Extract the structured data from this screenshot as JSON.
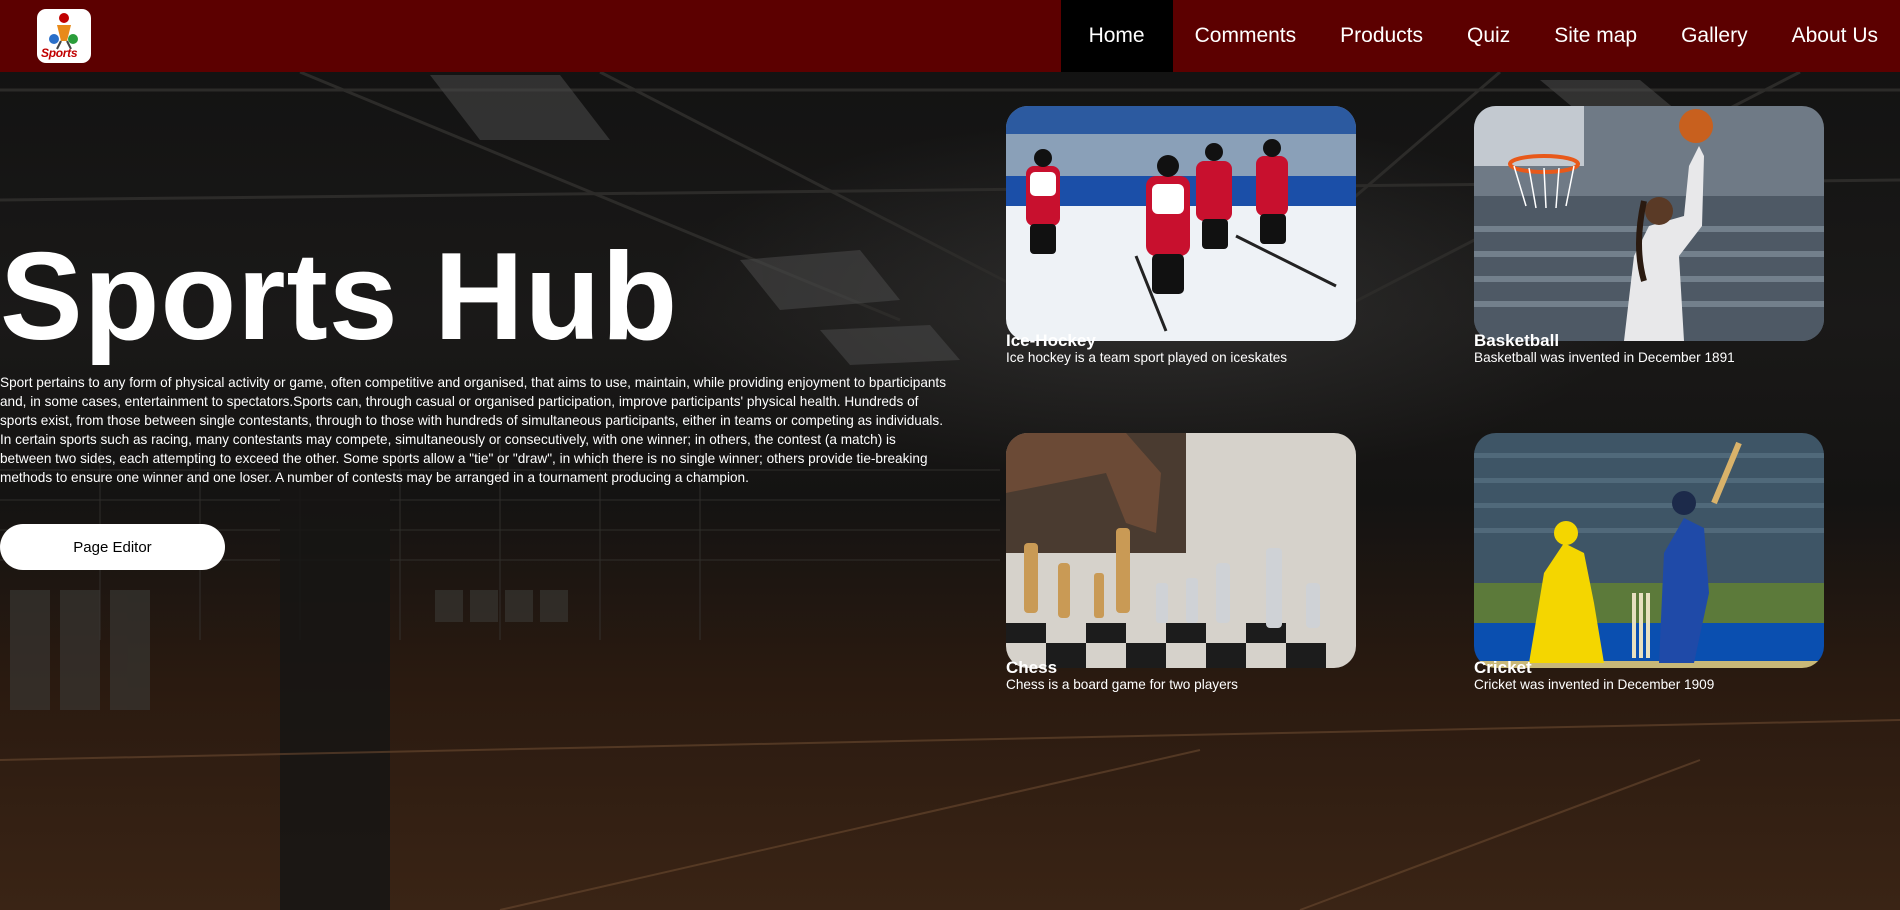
{
  "header": {
    "logo_text": "Sports",
    "nav": [
      {
        "label": "Home",
        "active": true
      },
      {
        "label": "Comments",
        "active": false
      },
      {
        "label": "Products",
        "active": false
      },
      {
        "label": "Quiz",
        "active": false
      },
      {
        "label": "Site map",
        "active": false
      },
      {
        "label": "Gallery",
        "active": false
      },
      {
        "label": "About Us",
        "active": false
      }
    ]
  },
  "hero": {
    "title": "Sports Hub",
    "text": "Sport pertains to any form of physical activity or game, often competitive and organised, that aims to use, maintain, while providing enjoyment to bparticipants and, in some cases, entertainment to spectators.Sports can, through casual or organised participation, improve participants' physical health. Hundreds of sports exist, from those between single contestants, through to those with hundreds of simultaneous participants, either in teams or competing as individuals. In certain sports such as racing, many contestants may compete, simultaneously or consecutively, with one winner; in others, the contest (a match) is between two sides, each attempting to exceed the other. Some sports allow a \"tie\" or \"draw\", in which there is no single winner; others provide tie-breaking methods to ensure one winner and one loser. A number of contests may be arranged in a tournament producing a champion.",
    "button_label": "Page Editor"
  },
  "cards": [
    {
      "title": "Ice-Hockey",
      "desc": "Ice hockey is a team sport played on iceskates"
    },
    {
      "title": "Basketball",
      "desc": "Basketball was invented in December 1891"
    },
    {
      "title": "Chess",
      "desc": "Chess is a board game for two players"
    },
    {
      "title": "Cricket",
      "desc": "Cricket was invented in December 1909"
    }
  ],
  "colors": {
    "header_bg": "#5c0000",
    "active_nav_bg": "#000000",
    "text": "#ffffff"
  }
}
